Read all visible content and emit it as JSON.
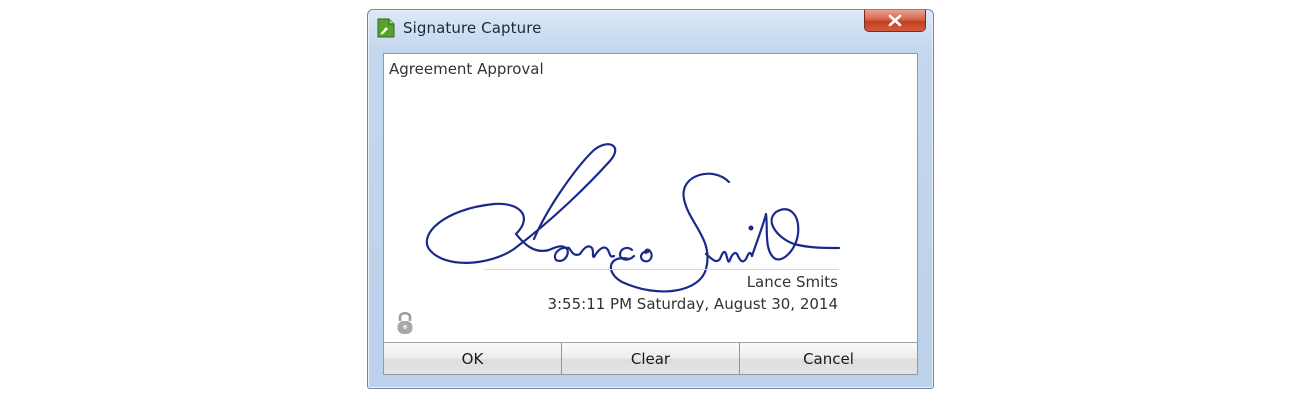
{
  "window": {
    "title": "Signature Capture",
    "app_icon": "document-pen-icon",
    "close_icon": "close-icon"
  },
  "form": {
    "caption": "Agreement Approval",
    "signer_name": "Lance Smits",
    "timestamp": "3:55:11 PM Saturday, August 30, 2014",
    "signature_image": "handwritten-signature",
    "lock_icon": "lock-icon"
  },
  "buttons": {
    "ok_label": "OK",
    "clear_label": "Clear",
    "cancel_label": "Cancel"
  },
  "colors": {
    "ink": "#1a2a8c",
    "close_button": "#c94a2c",
    "window_frame": "#c4d7ee"
  }
}
